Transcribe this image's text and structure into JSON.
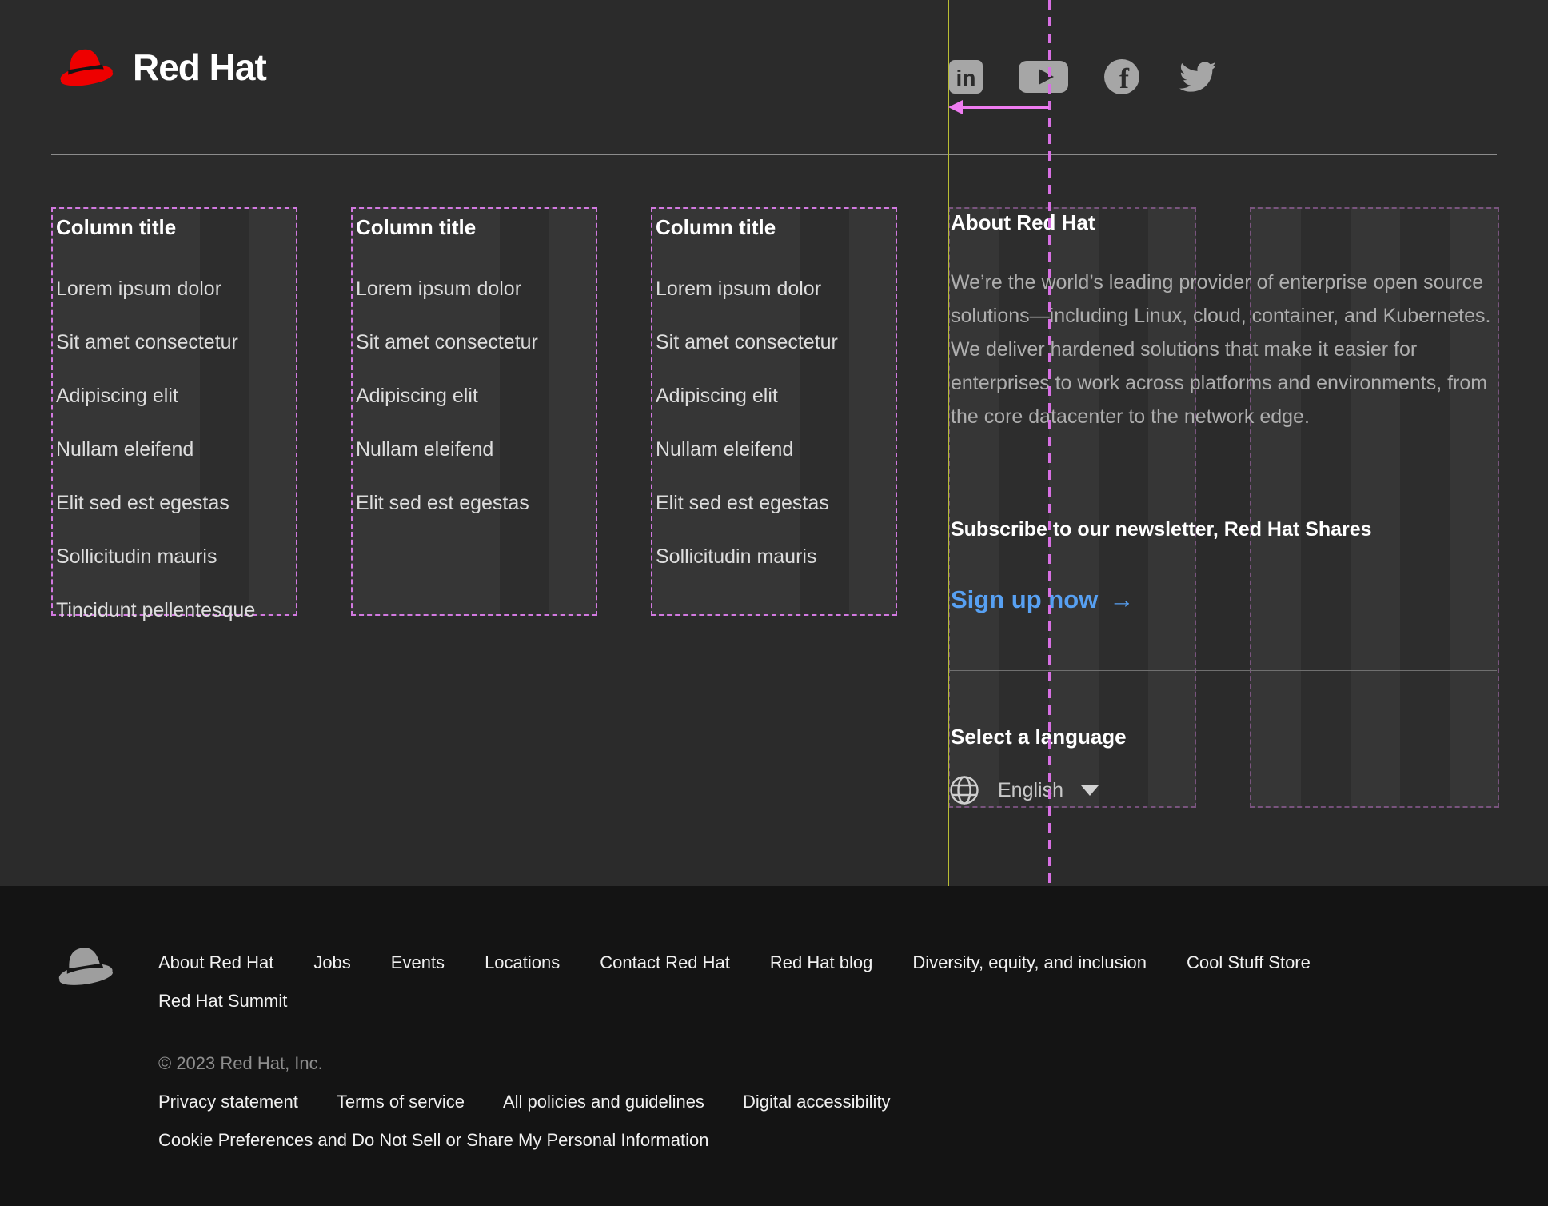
{
  "brand": {
    "logo_text": "Red Hat"
  },
  "social": {
    "icons": [
      "LinkedIn",
      "YouTube",
      "Facebook",
      "Twitter"
    ]
  },
  "columns": [
    {
      "title": "Column title",
      "links": [
        "Lorem ipsum dolor",
        "Sit amet consectetur",
        "Adipiscing elit",
        "Nullam eleifend",
        "Elit sed est egestas",
        "Sollicitudin mauris",
        "Tincidunt pellentesque"
      ]
    },
    {
      "title": "Column title",
      "links": [
        "Lorem ipsum dolor",
        "Sit amet consectetur",
        "Adipiscing elit",
        "Nullam eleifend",
        "Elit sed est egestas"
      ]
    },
    {
      "title": "Column title",
      "links": [
        "Lorem ipsum dolor",
        "Sit amet consectetur",
        "Adipiscing elit",
        "Nullam eleifend",
        "Elit sed est egestas",
        "Sollicitudin mauris"
      ]
    }
  ],
  "about": {
    "title": "About Red Hat",
    "body": "We’re the world’s leading provider of enterprise open source solutions—including Linux, cloud, container, and Kubernetes. We deliver hardened solutions that make it easier for enterprises to work across platforms and environments, from the core datacenter to the network edge.",
    "subscribe_heading": "Subscribe to our newsletter, Red Hat Shares",
    "signup_label": "Sign up now",
    "signup_arrow": "→"
  },
  "language": {
    "heading": "Select a language",
    "selected": "English"
  },
  "bottom_nav": {
    "row1": [
      "About Red Hat",
      "Jobs",
      "Events",
      "Locations",
      "Contact Red Hat",
      "Red Hat blog",
      "Diversity, equity, and inclusion",
      "Cool Stuff Store"
    ],
    "row2": [
      "Red Hat Summit"
    ]
  },
  "legal": {
    "copyright": "© 2023 Red Hat, Inc.",
    "links": [
      "Privacy statement",
      "Terms of service",
      "All policies and guidelines",
      "Digital accessibility"
    ],
    "cookie_link": "Cookie Preferences and Do Not Sell or Share My Personal Information"
  },
  "colors": {
    "brand_red": "#ee0000",
    "link_blue": "#57a0f2",
    "annotation_pink": "#d279e0",
    "annotation_magenta": "#ef7cf1",
    "annotation_yellow": "#b9bd33",
    "icon_gray": "#a6a6a6"
  }
}
